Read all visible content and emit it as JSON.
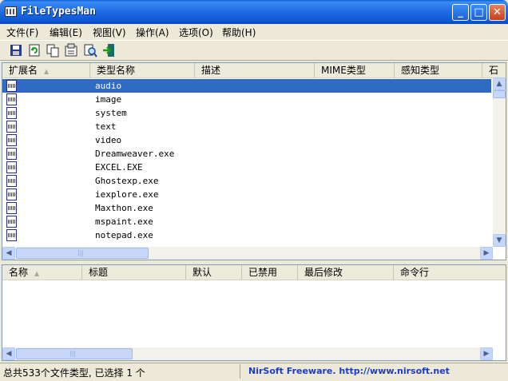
{
  "window": {
    "title": "FileTypesMan"
  },
  "titlebar_buttons": {
    "minimize": "_",
    "maximize": "□",
    "close": "✕"
  },
  "menu": [
    "文件(F)",
    "编辑(E)",
    "视图(V)",
    "操作(A)",
    "选项(O)",
    "帮助(H)"
  ],
  "toolbar_icons": [
    "save-icon",
    "refresh-icon",
    "copy-icon",
    "properties-icon",
    "find-icon",
    "exit-icon"
  ],
  "top_table": {
    "columns": [
      "扩展名",
      "类型名称",
      "描述",
      "MIME类型",
      "感知类型",
      "石"
    ],
    "sort_indicator": "▲",
    "rows": [
      "audio",
      "image",
      "system",
      "text",
      "video",
      "Dreamweaver.exe",
      "EXCEL.EXE",
      "Ghostexp.exe",
      "iexplore.exe",
      "Maxthon.exe",
      "mspaint.exe",
      "notepad.exe"
    ],
    "selected_index": 0
  },
  "bottom_table": {
    "columns": [
      "名称",
      "标题",
      "默认",
      "已禁用",
      "最后修改",
      "命令行"
    ],
    "sort_indicator": "▲"
  },
  "status": {
    "left": "总共533个文件类型, 已选择 1 个",
    "right": "NirSoft Freeware.  http://www.nirsoft.net"
  },
  "colors": {
    "selection": "#316ac5",
    "titlebar": "#0c58d4",
    "link": "#1a3dc4"
  }
}
